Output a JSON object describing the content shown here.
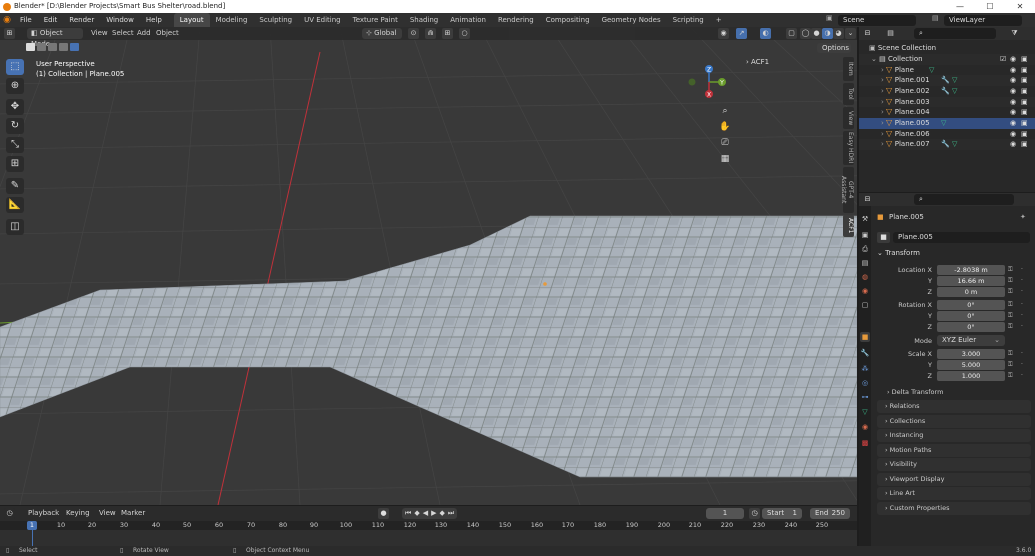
{
  "window": {
    "title": "Blender* [D:\\Blender Projects\\Smart Bus Shelter\\road.blend]",
    "controls": [
      "—",
      "☐",
      "✕"
    ]
  },
  "menu": [
    "File",
    "Edit",
    "Render",
    "Window",
    "Help"
  ],
  "workspaces": [
    "Layout",
    "Modeling",
    "Sculpting",
    "UV Editing",
    "Texture Paint",
    "Shading",
    "Animation",
    "Rendering",
    "Compositing",
    "Geometry Nodes",
    "Scripting",
    "+"
  ],
  "scene": {
    "label": "Scene",
    "viewlayer": "ViewLayer"
  },
  "viewport": {
    "mode": "Object Mode",
    "menus": [
      "View",
      "Select",
      "Add",
      "Object"
    ],
    "orientation": "Global",
    "options": "Options",
    "perspective": "User Perspective",
    "context": "(1) Collection | Plane.005",
    "overlay_item": "ACF1",
    "gizmo": {
      "x": "X",
      "y": "Y",
      "z": "Z"
    }
  },
  "sidebar_tabs": [
    "Item",
    "Tool",
    "View",
    "Easy HDRI",
    "GPT-4 Assistant",
    "ACF1"
  ],
  "outliner": {
    "root": "Scene Collection",
    "collection": "Collection",
    "objects": [
      "Plane",
      "Plane.001",
      "Plane.002",
      "Plane.003",
      "Plane.004",
      "Plane.005",
      "Plane.006",
      "Plane.007"
    ],
    "selected": "Plane.005"
  },
  "properties": {
    "object_name": "Plane.005",
    "data_name": "Plane.005",
    "transform_label": "Transform",
    "location": {
      "label": "Location X",
      "x": "-2.8038 m",
      "y": "16.66 m",
      "z": "0 m"
    },
    "rotation": {
      "label": "Rotation X",
      "x": "0°",
      "y": "0°",
      "z": "0°"
    },
    "mode": {
      "label": "Mode",
      "value": "XYZ Euler"
    },
    "scale": {
      "label": "Scale X",
      "x": "3.000",
      "y": "5.000",
      "z": "1.000"
    },
    "axis_labels": {
      "y": "Y",
      "z": "Z"
    },
    "panels": [
      "Delta Transform",
      "Relations",
      "Collections",
      "Instancing",
      "Motion Paths",
      "Visibility",
      "Viewport Display",
      "Line Art",
      "Custom Properties"
    ]
  },
  "timeline": {
    "menus": [
      "Playback",
      "Keying",
      "View",
      "Marker"
    ],
    "current_frame": "1",
    "start_label": "Start",
    "start": "1",
    "end_label": "End",
    "end": "250",
    "ticks": [
      "1",
      "10",
      "20",
      "30",
      "40",
      "50",
      "60",
      "70",
      "80",
      "90",
      "100",
      "110",
      "120",
      "130",
      "140",
      "150",
      "160",
      "170",
      "180",
      "190",
      "200",
      "210",
      "220",
      "230",
      "240",
      "250"
    ]
  },
  "status": {
    "select": "Select",
    "rotate": "Rotate View",
    "context_menu": "Object Context Menu",
    "version": "3.6.0"
  }
}
